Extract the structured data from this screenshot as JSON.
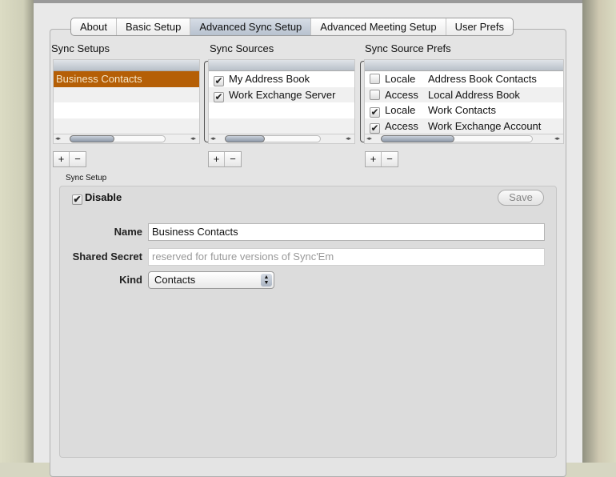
{
  "tabs": [
    "About",
    "Basic Setup",
    "Advanced Sync Setup",
    "Advanced Meeting Setup",
    "User Prefs"
  ],
  "active_tab": "Advanced Sync Setup",
  "sync_setups": {
    "label": "Sync Setups",
    "items": [
      "Business Contacts"
    ]
  },
  "sync_sources": {
    "label": "Sync Sources",
    "items": [
      {
        "name": "My Address Book",
        "checked": true
      },
      {
        "name": "Work Exchange Server",
        "checked": true
      }
    ]
  },
  "sync_source_prefs": {
    "label": "Sync Source Prefs",
    "items": [
      {
        "type": "Locale",
        "name": "Address Book Contacts",
        "checked": false
      },
      {
        "type": "Access",
        "name": "Local Address Book",
        "checked": false
      },
      {
        "type": "Locale",
        "name": "Work Contacts",
        "checked": true
      },
      {
        "type": "Access",
        "name": "Work Exchange Account",
        "checked": true
      }
    ]
  },
  "buttons": {
    "add": "+",
    "remove": "−",
    "save": "Save"
  },
  "sync_setup": {
    "group_label": "Sync Setup",
    "disable_label": "Disable",
    "disable_checked": true,
    "name_label": "Name",
    "name_value": "Business Contacts",
    "secret_label": "Shared Secret",
    "secret_placeholder": "reserved for future versions of Sync'Em",
    "kind_label": "Kind",
    "kind_value": "Contacts"
  },
  "check_glyph": "✔"
}
